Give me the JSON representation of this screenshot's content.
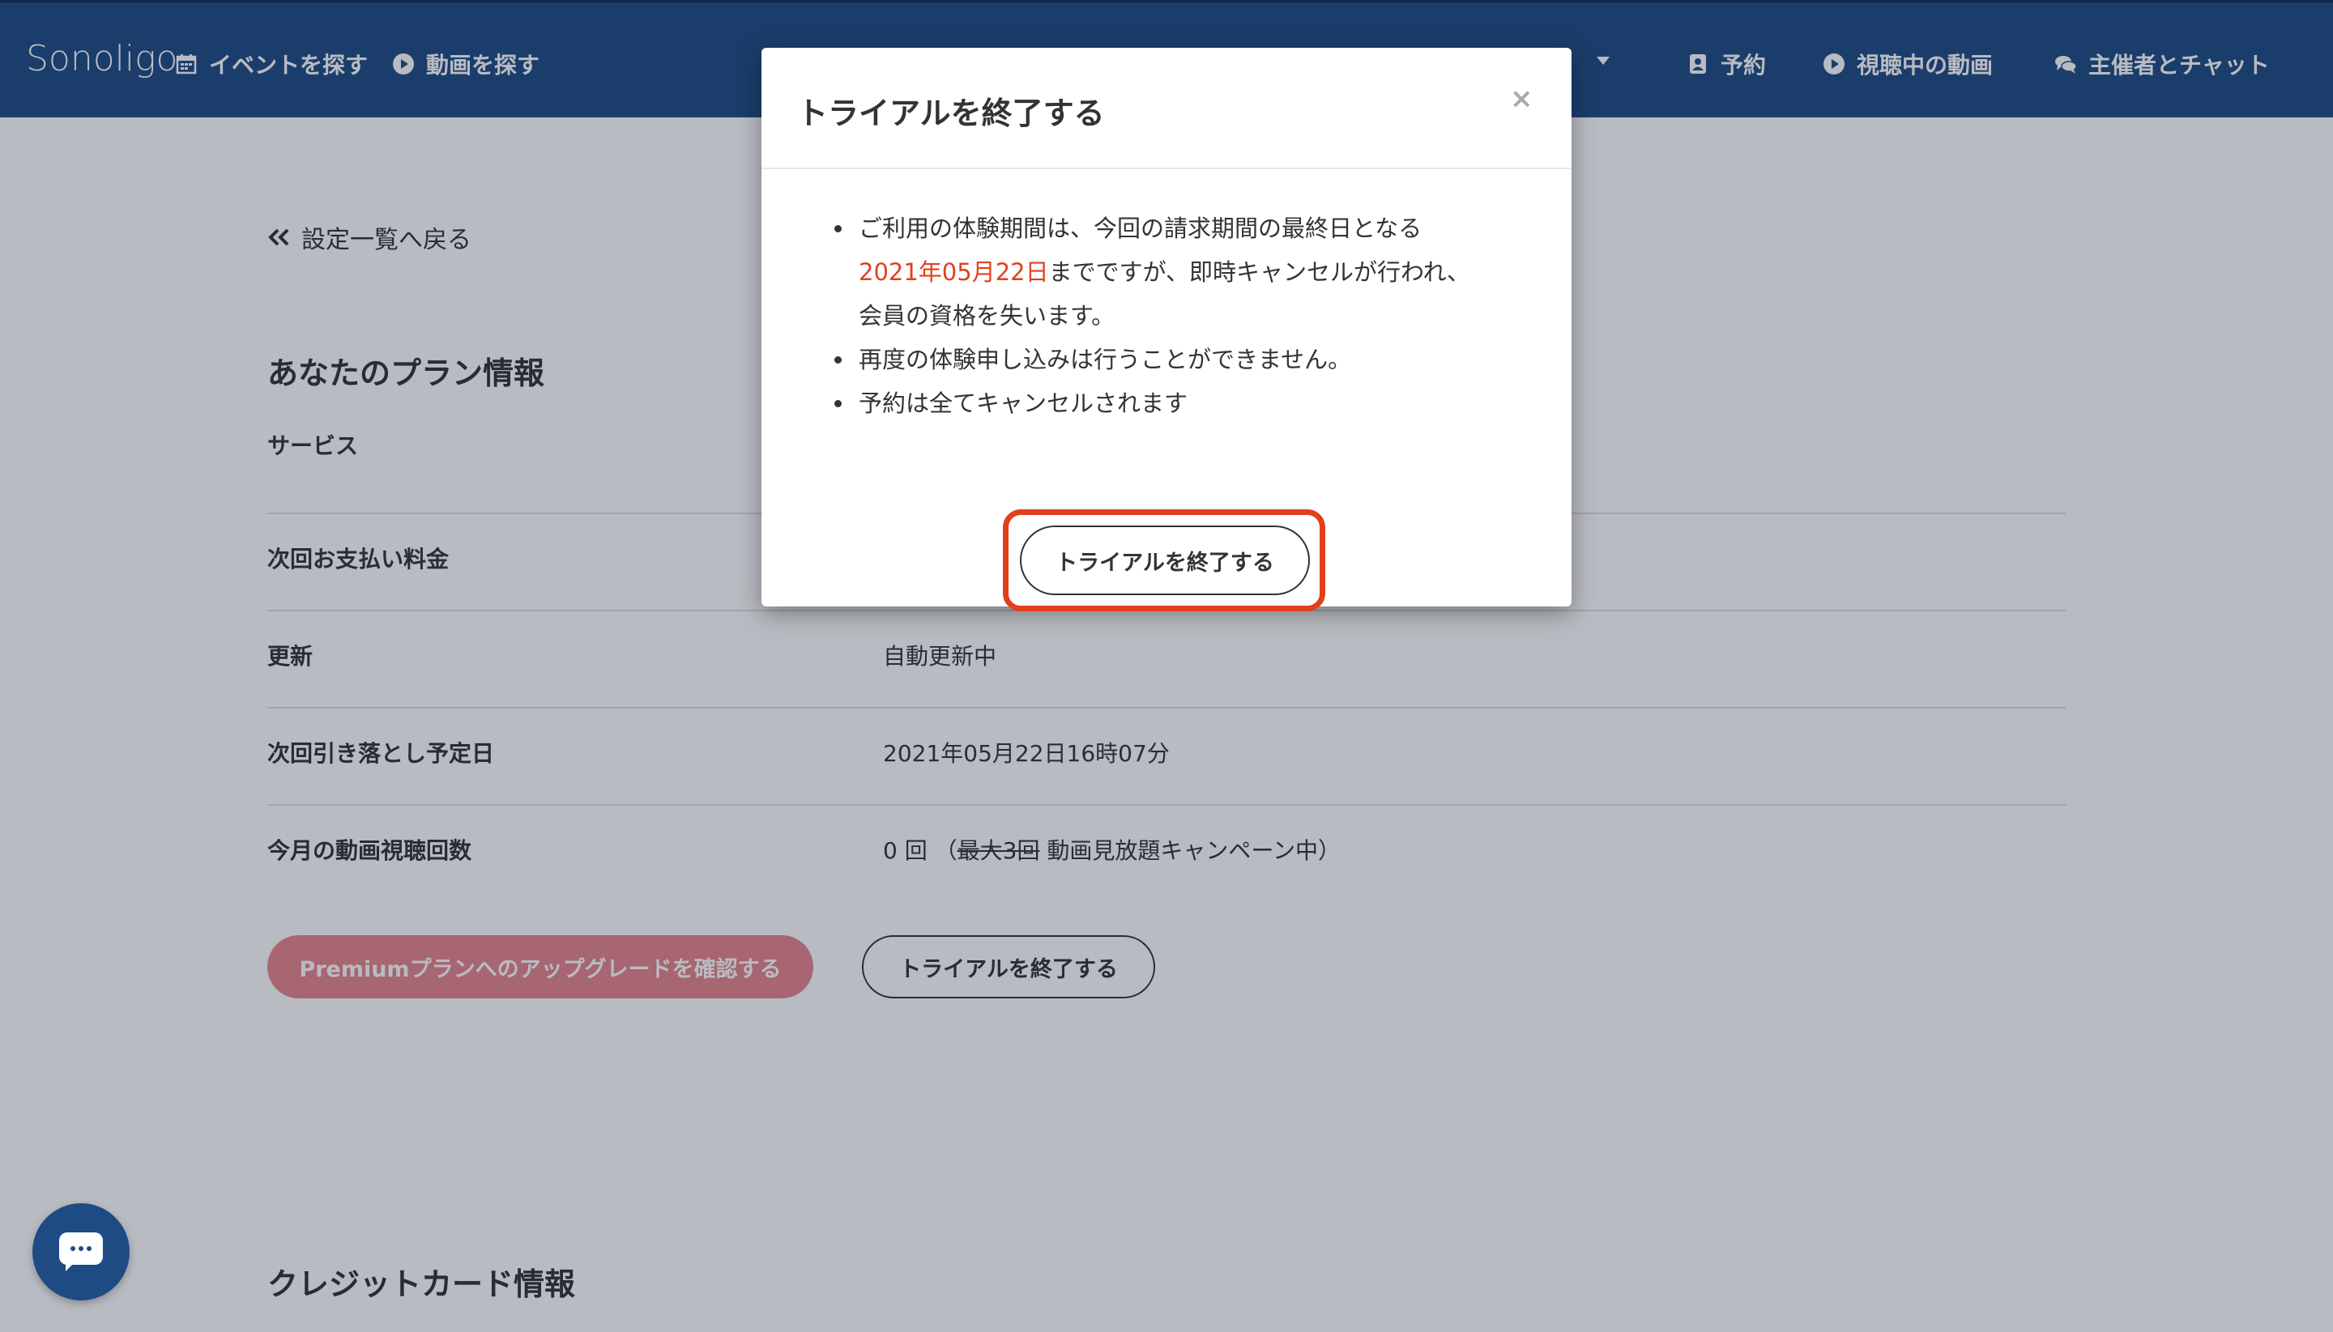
{
  "header": {
    "logo": "Sonoligo",
    "nav_left": [
      {
        "label": "イベントを探す",
        "icon": "calendar-icon"
      },
      {
        "label": "動画を探す",
        "icon": "play-circle-icon"
      }
    ],
    "nav_right": [
      {
        "label": "予約",
        "icon": "address-book-icon"
      },
      {
        "label": "視聴中の動画",
        "icon": "play-circle-icon"
      },
      {
        "label": "主催者とチャット",
        "icon": "chat-icon"
      }
    ]
  },
  "back_link": "設定一覧へ戻る",
  "plan": {
    "title": "あなたのプラン情報",
    "rows": [
      {
        "label": "サービス",
        "value": ""
      },
      {
        "label": "次回お支払い料金",
        "value": ""
      },
      {
        "label": "更新",
        "value": "自動更新中"
      },
      {
        "label": "次回引き落とし予定日",
        "value": "2021年05月22日16時07分"
      },
      {
        "label": "今月の動画視聴回数",
        "value_prefix": "0 回 （",
        "value_strike": "最大3回",
        "value_suffix": " 動画見放題キャンペーン中）"
      }
    ],
    "upgrade_button": "Premiumプランへのアップグレードを確認する",
    "end_trial_button": "トライアルを終了する"
  },
  "credit_card": {
    "title": "クレジットカード情報"
  },
  "modal": {
    "title": "トライアルを終了する",
    "close": "×",
    "notes": {
      "note1_line1": "ご利用の体験期間は、今回の請求期間の最終日となる",
      "note1_date": "2021年05月22日",
      "note1_line2": "までですが、即時キャンセルが行われ、",
      "note1_line3": "会員の資格を失います。",
      "note2": "再度の体験申し込みは行うことができません。",
      "note3": "予約は全てキャンセルされます"
    },
    "confirm_button": "トライアルを終了する"
  },
  "colors": {
    "header_bg": "#1f4b85",
    "accent_red": "#e2401c",
    "upgrade_pink": "#e8848f"
  }
}
